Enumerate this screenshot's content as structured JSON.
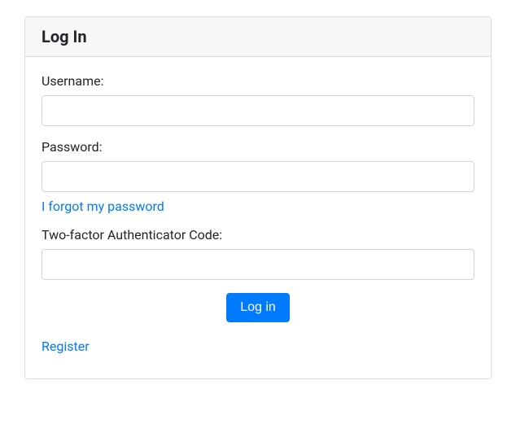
{
  "card": {
    "title": "Log In"
  },
  "form": {
    "username": {
      "label": "Username:",
      "value": ""
    },
    "password": {
      "label": "Password:",
      "value": ""
    },
    "forgot_link": "I forgot my password",
    "twofactor": {
      "label": "Two-factor Authenticator Code:",
      "value": ""
    },
    "submit_label": "Log in",
    "register_link": "Register"
  }
}
